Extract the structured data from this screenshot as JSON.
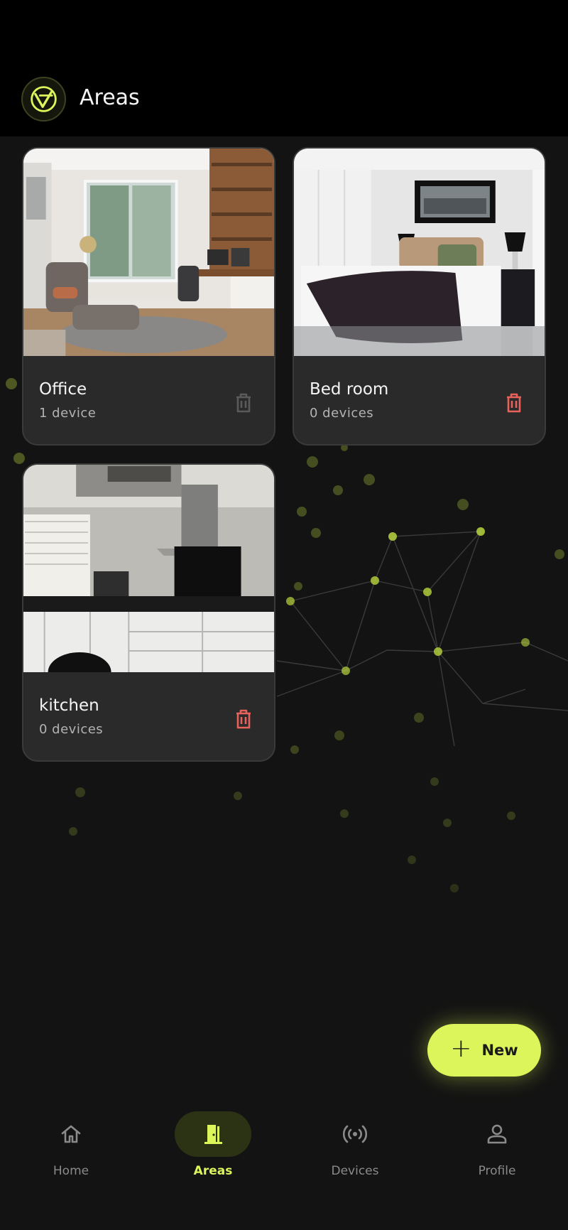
{
  "header": {
    "title": "Areas",
    "logo_icon": "vt-logo-icon"
  },
  "areas": [
    {
      "name": "Office",
      "count": "1 device",
      "delete_enabled": false,
      "image": "office-photo"
    },
    {
      "name": "Bed room",
      "count": "0 devices",
      "delete_enabled": true,
      "image": "bedroom-photo"
    },
    {
      "name": "kitchen",
      "count": "0 devices",
      "delete_enabled": true,
      "image": "kitchen-photo"
    }
  ],
  "fab": {
    "label": "New",
    "icon": "plus-icon"
  },
  "nav": [
    {
      "label": "Home",
      "icon": "home-icon",
      "active": false
    },
    {
      "label": "Areas",
      "icon": "door-icon",
      "active": true
    },
    {
      "label": "Devices",
      "icon": "signal-icon",
      "active": false
    },
    {
      "label": "Profile",
      "icon": "person-icon",
      "active": false
    }
  ],
  "colors": {
    "accent": "#dcf55a",
    "danger": "#e8625b",
    "disabled": "#5a5a5a",
    "card": "#2a2a2a",
    "background": "#131313"
  }
}
